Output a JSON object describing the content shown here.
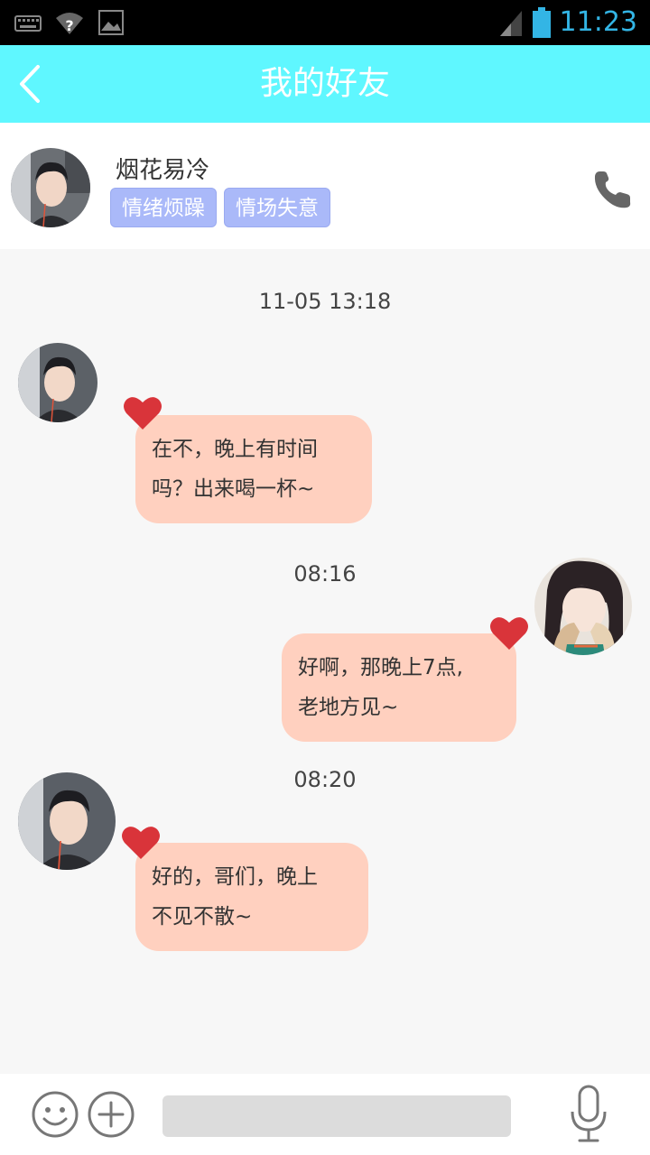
{
  "status_bar": {
    "time": "11:23",
    "icons": [
      "keyboard-icon",
      "wifi-question-icon",
      "image-icon",
      "signal-icon",
      "battery-icon"
    ],
    "time_color": "#33b5e5"
  },
  "header": {
    "title": "我的好友",
    "background": "#5ff7ff"
  },
  "friend": {
    "name": "烟花易冷",
    "tags": [
      "情绪烦躁",
      "情场失意"
    ]
  },
  "messages": [
    {
      "timestamp": "11-05  13:18",
      "side": "left",
      "lines": [
        "在不，晚上有时间",
        "吗？出来喝一杯~"
      ]
    },
    {
      "timestamp": "08:16",
      "side": "right",
      "lines": [
        "好啊，那晚上7点,",
        "老地方见~"
      ]
    },
    {
      "timestamp": "08:20",
      "side": "left",
      "lines": [
        "好的，哥们，晚上",
        "不见不散~"
      ]
    }
  ],
  "colors": {
    "bubble": "#ffd0bf",
    "heart": "#d9343a",
    "tag": "#aab9f9"
  },
  "input": {
    "value": "",
    "placeholder": ""
  }
}
